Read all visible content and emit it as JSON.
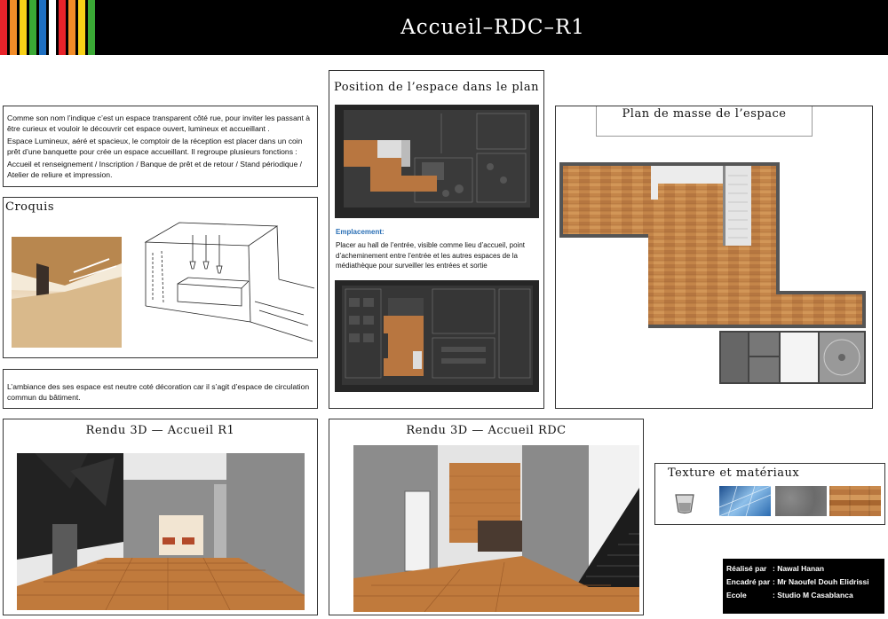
{
  "header": {
    "title": "Accueil–RDC–R1",
    "stripe_colors": [
      "#e8232a",
      "#f28c28",
      "#f7d117",
      "#3aa935",
      "#1e6fc1",
      "#ffffff",
      "#e8232a",
      "#f28c28",
      "#f7d117",
      "#3aa935"
    ]
  },
  "description": {
    "paragraph1": "Comme son nom l’indique c’est un espace transparent côté rue, pour inviter les passant à être curieux et vouloir le découvrir cet espace ouvert, lumineux et accueillant .",
    "paragraph2": "Espace Lumineux, aéré et spacieux, le comptoir de la réception est placer dans un coin prêt d’une banquette pour crée un espace accueillant. Il regroupe plusieurs fonctions :",
    "paragraph3": "Accueil et renseignement / Inscription  / Banque de prêt et de retour / Stand périodique / Atelier de reliure et impression."
  },
  "croquis": {
    "title": "Croquis"
  },
  "ambiance": {
    "text": "L’ambiance des ses espace est neutre coté décoration car il s’agit d’espace de circulation commun du bâtiment."
  },
  "position": {
    "title": "Position de l’espace dans le plan",
    "emplacement_label": "Emplacement:",
    "emplacement_text": "Placer au hall de l’entrée, visible comme lieu d’accueil, point d’acheminement entre l’entrée et les autres espaces de la médiathèque pour surveiller les entrées et sortie"
  },
  "plan_masse": {
    "title": "Plan de masse de l’espace"
  },
  "rendu_r1": {
    "title": "Rendu 3D — Accueil R1"
  },
  "rendu_rdc": {
    "title": "Rendu 3D — Accueil RDC"
  },
  "texture": {
    "title": "Texture et matériaux",
    "swatches": [
      "glass-cup",
      "blue-glass-facade",
      "grey-concrete",
      "light-wood"
    ]
  },
  "credits": {
    "realise_label": "Réalisé par",
    "realise_value": ": Nawal Hanan",
    "encadre_label": "Encadré par",
    "encadre_value": ": Mr Naoufel  Douh Elidrissi",
    "ecole_label": "Ecole",
    "ecole_value": ": Studio M Casablanca"
  }
}
